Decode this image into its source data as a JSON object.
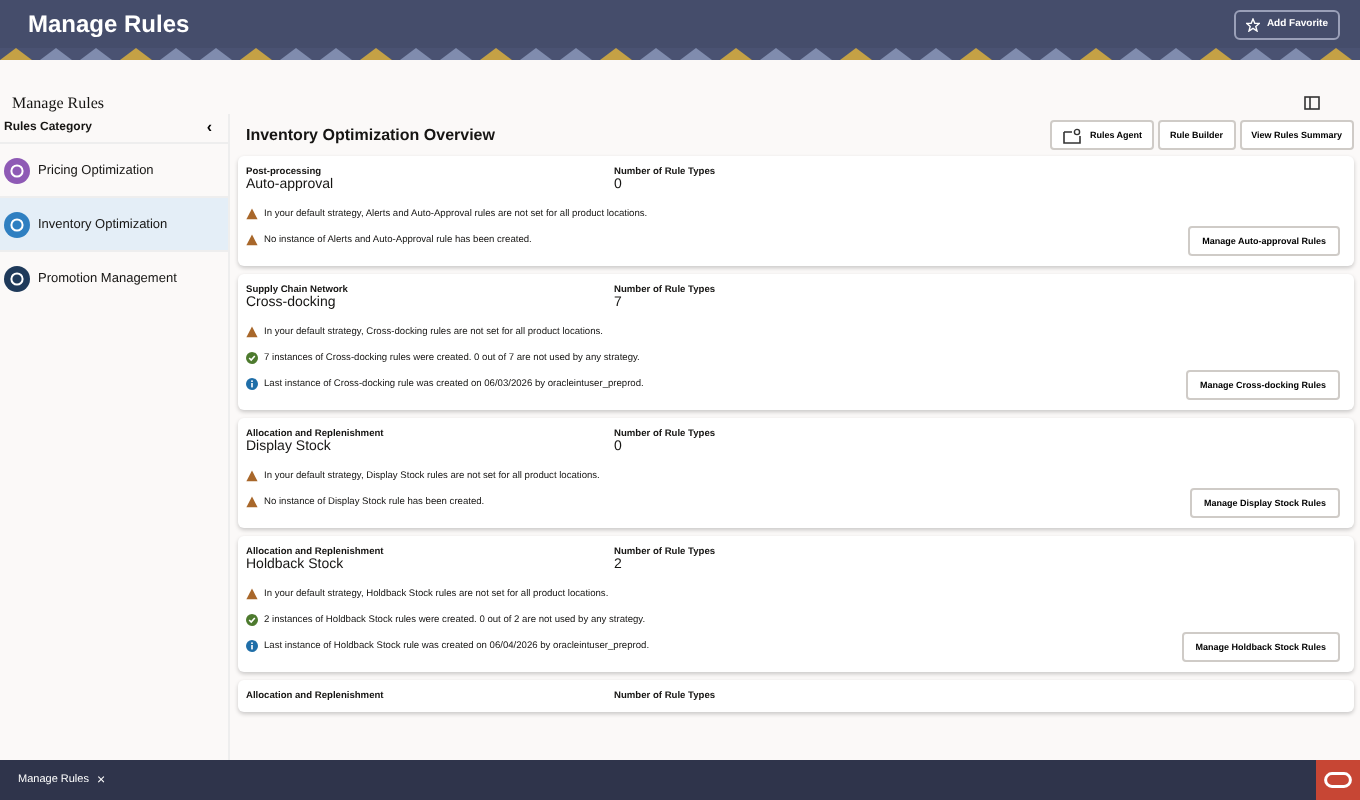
{
  "header": {
    "title": "Manage Rules",
    "favorite_button": "Add Favorite"
  },
  "page": {
    "title": "Manage Rules"
  },
  "sidebar": {
    "title": "Rules Category",
    "collapse": "‹",
    "items": [
      {
        "label": "Pricing Optimization",
        "selected": false,
        "color": "#8e5ab5"
      },
      {
        "label": "Inventory Optimization",
        "selected": true,
        "color": "#2f7fc1"
      },
      {
        "label": "Promotion Management",
        "selected": false,
        "color": "#1f3a5a"
      }
    ]
  },
  "main": {
    "title": "Inventory Optimization Overview",
    "buttons": [
      {
        "label": "Rules Agent",
        "kind": "agent"
      },
      {
        "label": "Rule Builder",
        "kind": "plain"
      },
      {
        "label": "View Rules Summary",
        "kind": "plain"
      }
    ],
    "cards": [
      {
        "category": "Post-processing",
        "title": "Auto-approval",
        "count_label": "Number of Rule Types",
        "count": "0",
        "messages": [
          {
            "kind": "warning",
            "text": "In your default strategy, Alerts and Auto-Approval rules are not set for all product locations."
          },
          {
            "kind": "warning",
            "text": "No instance of Alerts and Auto-Approval rule has been created."
          }
        ],
        "button": "Manage Auto-approval Rules"
      },
      {
        "category": "Supply Chain Network",
        "title": "Cross-docking",
        "count_label": "Number of Rule Types",
        "count": "7",
        "messages": [
          {
            "kind": "warning",
            "text": "In your default strategy, Cross-docking rules are not set for all product locations."
          },
          {
            "kind": "success",
            "text": "7 instances of Cross-docking rules were created. 0 out of 7 are not used by any strategy."
          },
          {
            "kind": "info",
            "text": "Last instance of Cross-docking rule was created on 06/03/2026 by oracleintuser_preprod."
          }
        ],
        "button": "Manage Cross-docking Rules"
      },
      {
        "category": "Allocation and Replenishment",
        "title": "Display Stock",
        "count_label": "Number of Rule Types",
        "count": "0",
        "messages": [
          {
            "kind": "warning",
            "text": "In your default strategy, Display Stock rules are not set for all product locations."
          },
          {
            "kind": "warning",
            "text": "No instance of Display Stock rule has been created."
          }
        ],
        "button": "Manage Display Stock Rules"
      },
      {
        "category": "Allocation and Replenishment",
        "title": "Holdback Stock",
        "count_label": "Number of Rule Types",
        "count": "2",
        "messages": [
          {
            "kind": "warning",
            "text": "In your default strategy, Holdback Stock rules are not set for all product locations."
          },
          {
            "kind": "success",
            "text": "2 instances of Holdback Stock rules were created. 0 out of 2 are not used by any strategy."
          },
          {
            "kind": "info",
            "text": "Last instance of Holdback Stock rule was created on 06/04/2026 by oracleintuser_preprod."
          }
        ],
        "button": "Manage Holdback Stock Rules"
      },
      {
        "category": "Allocation and Replenishment",
        "count_label": "Number of Rule Types"
      }
    ]
  },
  "footer": {
    "tab": "Manage Rules",
    "close": "×"
  }
}
